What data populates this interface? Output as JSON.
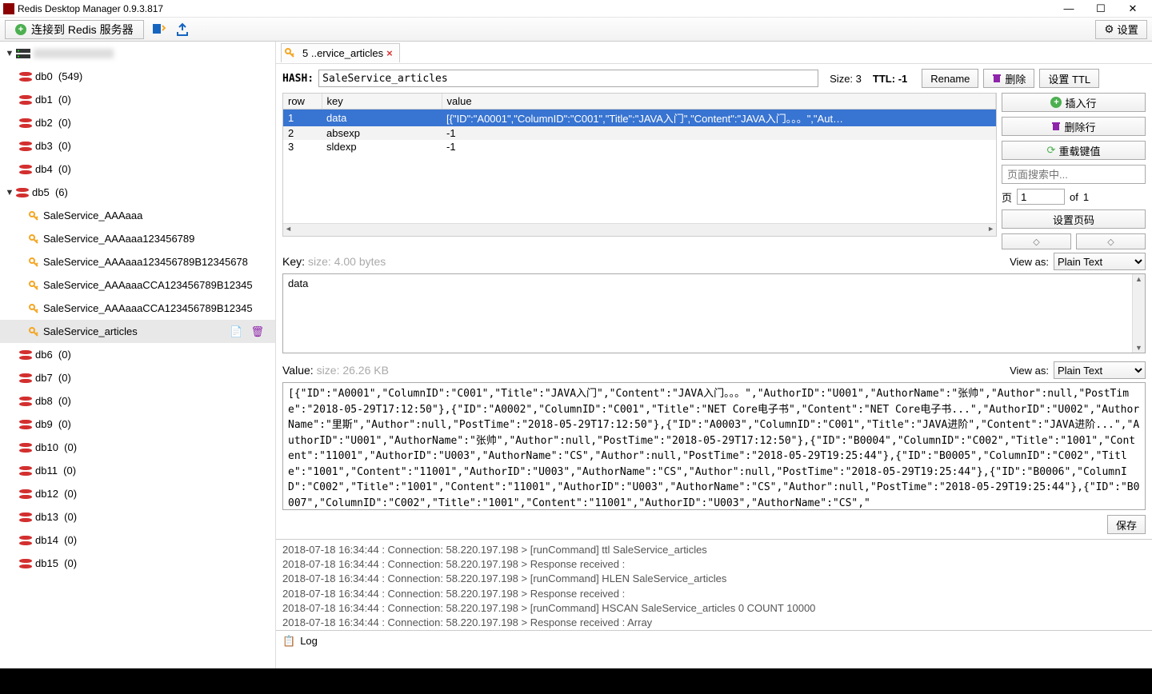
{
  "window": {
    "title": "Redis Desktop Manager 0.9.3.817"
  },
  "toolbar": {
    "connect": "连接到 Redis 服务器",
    "settings": "设置"
  },
  "sidebar": {
    "connection": "",
    "dbs": [
      {
        "name": "db0",
        "count": "(549)"
      },
      {
        "name": "db1",
        "count": "(0)"
      },
      {
        "name": "db2",
        "count": "(0)"
      },
      {
        "name": "db3",
        "count": "(0)"
      },
      {
        "name": "db4",
        "count": "(0)"
      }
    ],
    "db5": {
      "name": "db5",
      "count": "(6)"
    },
    "keys": [
      "SaleService_AAAaaa",
      "SaleService_AAAaaa123456789",
      "SaleService_AAAaaa123456789B12345678",
      "SaleService_AAAaaaCCA123456789B12345",
      "SaleService_AAAaaaCCA123456789B12345",
      "SaleService_articles"
    ],
    "dbs_after": [
      {
        "name": "db6",
        "count": "(0)"
      },
      {
        "name": "db7",
        "count": "(0)"
      },
      {
        "name": "db8",
        "count": "(0)"
      },
      {
        "name": "db9",
        "count": "(0)"
      },
      {
        "name": "db10",
        "count": "(0)"
      },
      {
        "name": "db11",
        "count": "(0)"
      },
      {
        "name": "db12",
        "count": "(0)"
      },
      {
        "name": "db13",
        "count": "(0)"
      },
      {
        "name": "db14",
        "count": "(0)"
      },
      {
        "name": "db15",
        "count": "(0)"
      }
    ]
  },
  "tab": {
    "label": "5             ..ervice_articles"
  },
  "header": {
    "type_label": "HASH:",
    "key_name": "SaleService_articles",
    "size_label": "Size:",
    "size_value": "3",
    "ttl_label": "TTL:",
    "ttl_value": "-1",
    "rename": "Rename",
    "delete": "删除",
    "set_ttl": "设置 TTL"
  },
  "table": {
    "hdr_row": "row",
    "hdr_key": "key",
    "hdr_value": "value",
    "rows": [
      {
        "n": "1",
        "k": "data",
        "v": "[{\"ID\":\"A0001\",\"ColumnID\":\"C001\",\"Title\":\"JAVA入门\",\"Content\":\"JAVA入门。。。\",\"Aut…"
      },
      {
        "n": "2",
        "k": "absexp",
        "v": "-1"
      },
      {
        "n": "3",
        "k": "sldexp",
        "v": "-1"
      }
    ]
  },
  "right_panel": {
    "insert": "插入行",
    "delete_row": "删除行",
    "reload": "重载键值",
    "search_placeholder": "页面搜索中...",
    "page_label": "页",
    "page_value": "1",
    "of": "of",
    "total": "1",
    "set_page": "设置页码"
  },
  "key_section": {
    "label": "Key:",
    "size": "size: 4.00 bytes",
    "viewas": "View as:",
    "mode": "Plain Text",
    "value": "data"
  },
  "val_section": {
    "label": "Value:",
    "size": "size: 26.26 KB",
    "viewas": "View as:",
    "mode": "Plain Text",
    "value": "[{\"ID\":\"A0001\",\"ColumnID\":\"C001\",\"Title\":\"JAVA入门\",\"Content\":\"JAVA入门。。。\",\"AuthorID\":\"U001\",\"AuthorName\":\"张帅\",\"Author\":null,\"PostTime\":\"2018-05-29T17:12:50\"},{\"ID\":\"A0002\",\"ColumnID\":\"C001\",\"Title\":\"NET Core电子书\",\"Content\":\"NET Core电子书...\",\"AuthorID\":\"U002\",\"AuthorName\":\"里斯\",\"Author\":null,\"PostTime\":\"2018-05-29T17:12:50\"},{\"ID\":\"A0003\",\"ColumnID\":\"C001\",\"Title\":\"JAVA进阶\",\"Content\":\"JAVA进阶...\",\"AuthorID\":\"U001\",\"AuthorName\":\"张帅\",\"Author\":null,\"PostTime\":\"2018-05-29T17:12:50\"},{\"ID\":\"B0004\",\"ColumnID\":\"C002\",\"Title\":\"1001\",\"Content\":\"11001\",\"AuthorID\":\"U003\",\"AuthorName\":\"CS\",\"Author\":null,\"PostTime\":\"2018-05-29T19:25:44\"},{\"ID\":\"B0005\",\"ColumnID\":\"C002\",\"Title\":\"1001\",\"Content\":\"11001\",\"AuthorID\":\"U003\",\"AuthorName\":\"CS\",\"Author\":null,\"PostTime\":\"2018-05-29T19:25:44\"},{\"ID\":\"B0006\",\"ColumnID\":\"C002\",\"Title\":\"1001\",\"Content\":\"11001\",\"AuthorID\":\"U003\",\"AuthorName\":\"CS\",\"Author\":null,\"PostTime\":\"2018-05-29T19:25:44\"},{\"ID\":\"B0007\",\"ColumnID\":\"C002\",\"Title\":\"1001\",\"Content\":\"11001\",\"AuthorID\":\"U003\",\"AuthorName\":\"CS\",\""
  },
  "save": "保存",
  "log": {
    "lines": [
      "2018-07-18 16:34:44 : Connection: 58.220.197.198 > [runCommand] ttl SaleService_articles",
      "2018-07-18 16:34:44 : Connection: 58.220.197.198 > Response received :",
      "2018-07-18 16:34:44 : Connection: 58.220.197.198 > [runCommand] HLEN SaleService_articles",
      "2018-07-18 16:34:44 : Connection: 58.220.197.198 > Response received :",
      "2018-07-18 16:34:44 : Connection: 58.220.197.198 > [runCommand] HSCAN SaleService_articles 0 COUNT 10000",
      "2018-07-18 16:34:44 : Connection: 58.220.197.198 > Response received : Array"
    ],
    "footer": "Log"
  }
}
